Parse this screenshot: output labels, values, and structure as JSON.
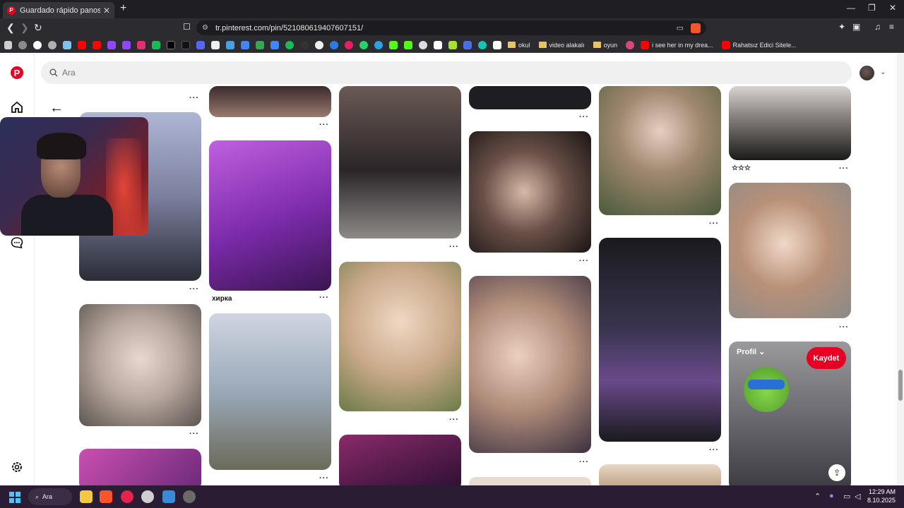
{
  "browser": {
    "tab_title": "Guardado rápido panosundaki P",
    "tab_favicon": "P",
    "tab_close": "✕",
    "new_tab": "+",
    "url": "tr.pinterest.com/pin/521080619407607151/",
    "bookmark_folders": [
      "okul",
      "video alakalı",
      "oyun",
      "i see her in my drea...",
      "Rahatsız Edici Sitele..."
    ]
  },
  "pinterest": {
    "logo": "P",
    "search_placeholder": "Ara",
    "back_arrow": "←",
    "avatar_chevron": "⌄",
    "dots": "···",
    "pin_title_1": "хирка",
    "pin_title_2": "☆☆☆",
    "hover_profile": "Profil ⌄",
    "save_label": "Kaydet",
    "share_icon": "⇪"
  },
  "taskbar": {
    "search_label": "Ara",
    "time": "12:29 AM",
    "date": "8.10.2025"
  },
  "colors": {
    "brand_red": "#e60023",
    "tab_bg": "#1f1f23",
    "taskbar_bg": "#2a1d33"
  }
}
